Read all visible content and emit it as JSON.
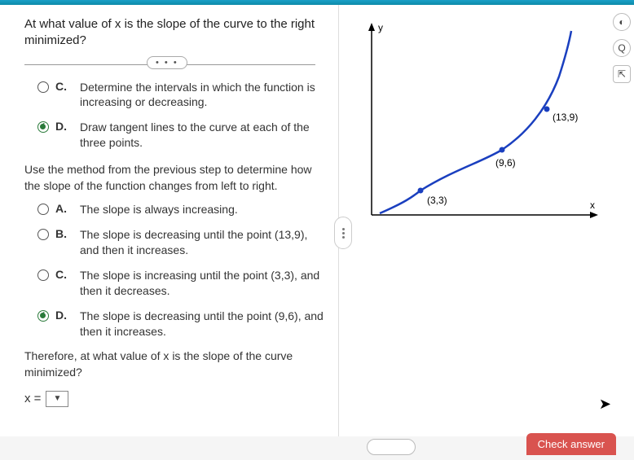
{
  "question": {
    "title": "At what value of x is the slope of the curve to the right minimized?",
    "divider_dots": "• • •"
  },
  "group1": {
    "c": {
      "letter": "C.",
      "text": "Determine the intervals in which the function is increasing or decreasing."
    },
    "d": {
      "letter": "D.",
      "text": "Draw tangent lines to the curve at each of the three points."
    }
  },
  "sub_prompt": "Use the method from the previous step to determine how the slope of the function changes from left to right.",
  "group2": {
    "a": {
      "letter": "A.",
      "text": "The slope is always increasing."
    },
    "b": {
      "letter": "B.",
      "text": "The slope is decreasing until the point (13,9), and then it increases."
    },
    "c": {
      "letter": "C.",
      "text": "The slope is increasing until the point (3,3), and then it decreases."
    },
    "d": {
      "letter": "D.",
      "text": "The slope is decreasing until the point (9,6), and then it increases."
    }
  },
  "final_prompt": "Therefore, at what value of x is the slope of the curve minimized?",
  "answer": {
    "prefix": "x =",
    "dropdown_glyph": "▼"
  },
  "chart_data": {
    "type": "line",
    "title": "",
    "xlabel": "x",
    "ylabel": "y",
    "points": [
      {
        "x": 3,
        "y": 3,
        "label": "(3,3)"
      },
      {
        "x": 9,
        "y": 6,
        "label": "(9,6)"
      },
      {
        "x": 13,
        "y": 9,
        "label": "(13,9)"
      }
    ],
    "xlim": [
      0,
      16
    ],
    "ylim": [
      0,
      18
    ]
  },
  "side": {
    "toggle": "◐",
    "zoom": "Q",
    "popout": "⇱"
  },
  "footer": {
    "button": "Check answer"
  }
}
